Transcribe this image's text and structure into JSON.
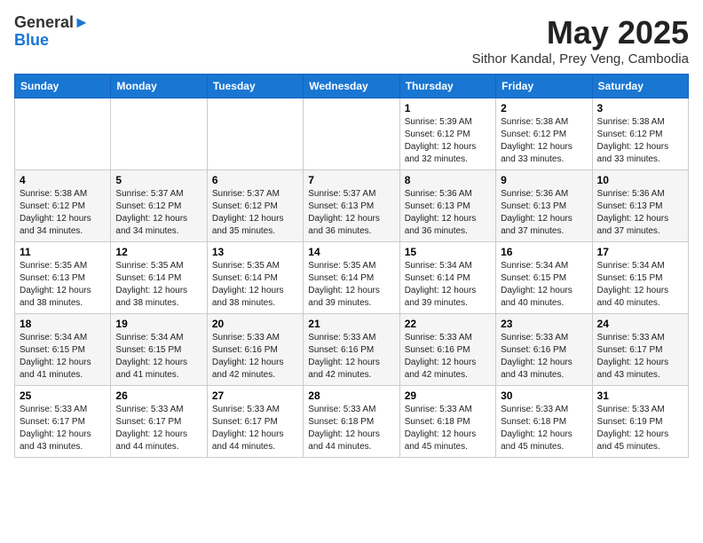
{
  "logo": {
    "line1": "General",
    "line2": "Blue"
  },
  "title": "May 2025",
  "subtitle": "Sithor Kandal, Prey Veng, Cambodia",
  "days_header": [
    "Sunday",
    "Monday",
    "Tuesday",
    "Wednesday",
    "Thursday",
    "Friday",
    "Saturday"
  ],
  "weeks": [
    [
      {
        "day": "",
        "info": ""
      },
      {
        "day": "",
        "info": ""
      },
      {
        "day": "",
        "info": ""
      },
      {
        "day": "",
        "info": ""
      },
      {
        "day": "1",
        "info": "Sunrise: 5:39 AM\nSunset: 6:12 PM\nDaylight: 12 hours\nand 32 minutes."
      },
      {
        "day": "2",
        "info": "Sunrise: 5:38 AM\nSunset: 6:12 PM\nDaylight: 12 hours\nand 33 minutes."
      },
      {
        "day": "3",
        "info": "Sunrise: 5:38 AM\nSunset: 6:12 PM\nDaylight: 12 hours\nand 33 minutes."
      }
    ],
    [
      {
        "day": "4",
        "info": "Sunrise: 5:38 AM\nSunset: 6:12 PM\nDaylight: 12 hours\nand 34 minutes."
      },
      {
        "day": "5",
        "info": "Sunrise: 5:37 AM\nSunset: 6:12 PM\nDaylight: 12 hours\nand 34 minutes."
      },
      {
        "day": "6",
        "info": "Sunrise: 5:37 AM\nSunset: 6:12 PM\nDaylight: 12 hours\nand 35 minutes."
      },
      {
        "day": "7",
        "info": "Sunrise: 5:37 AM\nSunset: 6:13 PM\nDaylight: 12 hours\nand 36 minutes."
      },
      {
        "day": "8",
        "info": "Sunrise: 5:36 AM\nSunset: 6:13 PM\nDaylight: 12 hours\nand 36 minutes."
      },
      {
        "day": "9",
        "info": "Sunrise: 5:36 AM\nSunset: 6:13 PM\nDaylight: 12 hours\nand 37 minutes."
      },
      {
        "day": "10",
        "info": "Sunrise: 5:36 AM\nSunset: 6:13 PM\nDaylight: 12 hours\nand 37 minutes."
      }
    ],
    [
      {
        "day": "11",
        "info": "Sunrise: 5:35 AM\nSunset: 6:13 PM\nDaylight: 12 hours\nand 38 minutes."
      },
      {
        "day": "12",
        "info": "Sunrise: 5:35 AM\nSunset: 6:14 PM\nDaylight: 12 hours\nand 38 minutes."
      },
      {
        "day": "13",
        "info": "Sunrise: 5:35 AM\nSunset: 6:14 PM\nDaylight: 12 hours\nand 38 minutes."
      },
      {
        "day": "14",
        "info": "Sunrise: 5:35 AM\nSunset: 6:14 PM\nDaylight: 12 hours\nand 39 minutes."
      },
      {
        "day": "15",
        "info": "Sunrise: 5:34 AM\nSunset: 6:14 PM\nDaylight: 12 hours\nand 39 minutes."
      },
      {
        "day": "16",
        "info": "Sunrise: 5:34 AM\nSunset: 6:15 PM\nDaylight: 12 hours\nand 40 minutes."
      },
      {
        "day": "17",
        "info": "Sunrise: 5:34 AM\nSunset: 6:15 PM\nDaylight: 12 hours\nand 40 minutes."
      }
    ],
    [
      {
        "day": "18",
        "info": "Sunrise: 5:34 AM\nSunset: 6:15 PM\nDaylight: 12 hours\nand 41 minutes."
      },
      {
        "day": "19",
        "info": "Sunrise: 5:34 AM\nSunset: 6:15 PM\nDaylight: 12 hours\nand 41 minutes."
      },
      {
        "day": "20",
        "info": "Sunrise: 5:33 AM\nSunset: 6:16 PM\nDaylight: 12 hours\nand 42 minutes."
      },
      {
        "day": "21",
        "info": "Sunrise: 5:33 AM\nSunset: 6:16 PM\nDaylight: 12 hours\nand 42 minutes."
      },
      {
        "day": "22",
        "info": "Sunrise: 5:33 AM\nSunset: 6:16 PM\nDaylight: 12 hours\nand 42 minutes."
      },
      {
        "day": "23",
        "info": "Sunrise: 5:33 AM\nSunset: 6:16 PM\nDaylight: 12 hours\nand 43 minutes."
      },
      {
        "day": "24",
        "info": "Sunrise: 5:33 AM\nSunset: 6:17 PM\nDaylight: 12 hours\nand 43 minutes."
      }
    ],
    [
      {
        "day": "25",
        "info": "Sunrise: 5:33 AM\nSunset: 6:17 PM\nDaylight: 12 hours\nand 43 minutes."
      },
      {
        "day": "26",
        "info": "Sunrise: 5:33 AM\nSunset: 6:17 PM\nDaylight: 12 hours\nand 44 minutes."
      },
      {
        "day": "27",
        "info": "Sunrise: 5:33 AM\nSunset: 6:17 PM\nDaylight: 12 hours\nand 44 minutes."
      },
      {
        "day": "28",
        "info": "Sunrise: 5:33 AM\nSunset: 6:18 PM\nDaylight: 12 hours\nand 44 minutes."
      },
      {
        "day": "29",
        "info": "Sunrise: 5:33 AM\nSunset: 6:18 PM\nDaylight: 12 hours\nand 45 minutes."
      },
      {
        "day": "30",
        "info": "Sunrise: 5:33 AM\nSunset: 6:18 PM\nDaylight: 12 hours\nand 45 minutes."
      },
      {
        "day": "31",
        "info": "Sunrise: 5:33 AM\nSunset: 6:19 PM\nDaylight: 12 hours\nand 45 minutes."
      }
    ]
  ]
}
